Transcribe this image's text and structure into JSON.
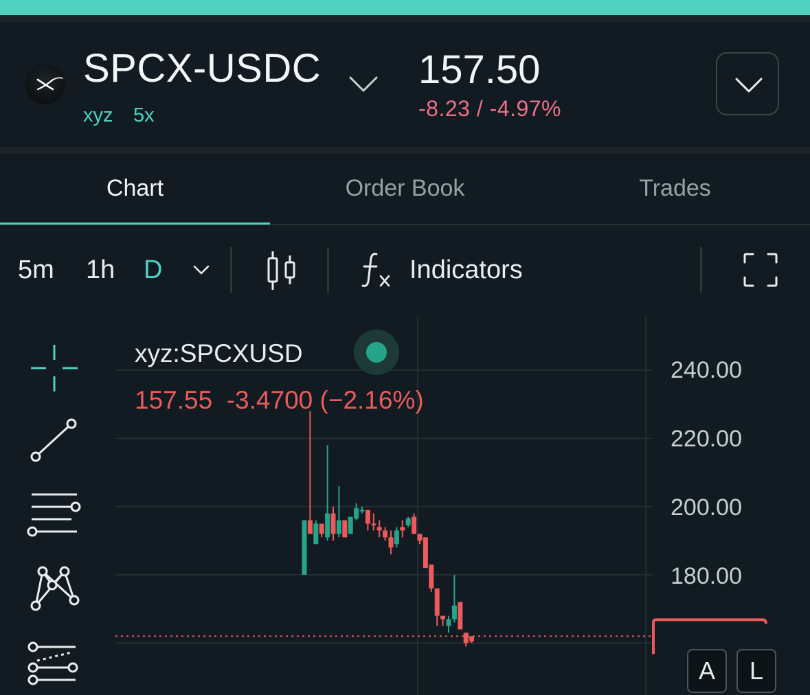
{
  "header": {
    "pair": "SPCX-USDC",
    "tags": [
      "xyz",
      "5x"
    ],
    "price": "157.50",
    "change": "-8.23 / -4.97%"
  },
  "tabs": [
    {
      "label": "Chart",
      "active": true
    },
    {
      "label": "Order Book",
      "active": false
    },
    {
      "label": "Trades",
      "active": false
    }
  ],
  "toolbar": {
    "timeframes": [
      {
        "label": "5m",
        "active": false
      },
      {
        "label": "1h",
        "active": false
      },
      {
        "label": "D",
        "active": true
      }
    ],
    "indicators_label": "Indicators"
  },
  "legend": {
    "symbol": "xyz:SPCXUSD",
    "last": "157.55",
    "change": "-3.4700",
    "change_pct": "(−2.16%)"
  },
  "axis_buttons": [
    "A",
    "L"
  ],
  "colors": {
    "accent": "#50d2c1",
    "up": "#26a48a",
    "down": "#ec5b5b",
    "background": "#111b21"
  },
  "icons": [
    "x-logo-icon",
    "chevron-down-icon",
    "candlestick-icon",
    "function-icon",
    "fullscreen-icon",
    "crosshair-icon",
    "trend-line-icon",
    "horizontal-lines-icon",
    "pattern-icon",
    "fib-tool-icon"
  ],
  "chart_data": {
    "type": "candlestick",
    "y_ticks": [
      "240.00",
      "220.00",
      "200.00",
      "180.00"
    ],
    "ylim": [
      160,
      240
    ],
    "last_price": 162,
    "candles": [
      {
        "o": 180.0,
        "h": 196.0,
        "l": 180.0,
        "c": 196.0
      },
      {
        "o": 196.0,
        "h": 228.0,
        "l": 192.0,
        "c": 192.0
      },
      {
        "o": 189.0,
        "h": 196.0,
        "l": 191.0,
        "c": 195.0
      },
      {
        "o": 195.0,
        "h": 195.0,
        "l": 191.0,
        "c": 192.0
      },
      {
        "o": 191.0,
        "h": 218.0,
        "l": 190.0,
        "c": 198.0
      },
      {
        "o": 198.0,
        "h": 200.0,
        "l": 190.0,
        "c": 192.0
      },
      {
        "o": 192.0,
        "h": 206.0,
        "l": 191.0,
        "c": 196.0
      },
      {
        "o": 196.0,
        "h": 196.0,
        "l": 191.0,
        "c": 191.0
      },
      {
        "o": 192.0,
        "h": 197.0,
        "l": 192.0,
        "c": 197.0
      },
      {
        "o": 196.5,
        "h": 201.0,
        "l": 196.0,
        "c": 199.5
      },
      {
        "o": 199.0,
        "h": 200.0,
        "l": 198.0,
        "c": 199.0
      },
      {
        "o": 199.0,
        "h": 199.0,
        "l": 193.0,
        "c": 195.0
      },
      {
        "o": 195.0,
        "h": 198.0,
        "l": 193.0,
        "c": 194.5
      },
      {
        "o": 194.0,
        "h": 196.0,
        "l": 191.0,
        "c": 193.0
      },
      {
        "o": 193.0,
        "h": 194.0,
        "l": 190.0,
        "c": 191.0
      },
      {
        "o": 191.0,
        "h": 193.0,
        "l": 186.0,
        "c": 188.0
      },
      {
        "o": 189.0,
        "h": 194.0,
        "l": 188.0,
        "c": 193.0
      },
      {
        "o": 194.0,
        "h": 196.0,
        "l": 191.0,
        "c": 193.0
      },
      {
        "o": 194.5,
        "h": 197.0,
        "l": 194.0,
        "c": 196.5
      },
      {
        "o": 197.0,
        "h": 198.0,
        "l": 192.0,
        "c": 192.0
      },
      {
        "o": 192.0,
        "h": 192.0,
        "l": 189.0,
        "c": 190.0
      },
      {
        "o": 191.0,
        "h": 191.0,
        "l": 182.0,
        "c": 182.0
      },
      {
        "o": 183.0,
        "h": 183.0,
        "l": 175.0,
        "c": 176.0
      },
      {
        "o": 176.0,
        "h": 176.0,
        "l": 165.0,
        "c": 168.0
      },
      {
        "o": 168.0,
        "h": 168.0,
        "l": 165.0,
        "c": 167.0
      },
      {
        "o": 165.0,
        "h": 168.0,
        "l": 163.0,
        "c": 167.0
      },
      {
        "o": 167.0,
        "h": 180.0,
        "l": 166.0,
        "c": 171.0
      },
      {
        "o": 172.0,
        "h": 172.0,
        "l": 164.0,
        "c": 164.0
      },
      {
        "o": 163.0,
        "h": 163.0,
        "l": 159.0,
        "c": 160.0
      },
      {
        "o": 162.0,
        "h": 162.0,
        "l": 160.0,
        "c": 160.5
      }
    ]
  }
}
